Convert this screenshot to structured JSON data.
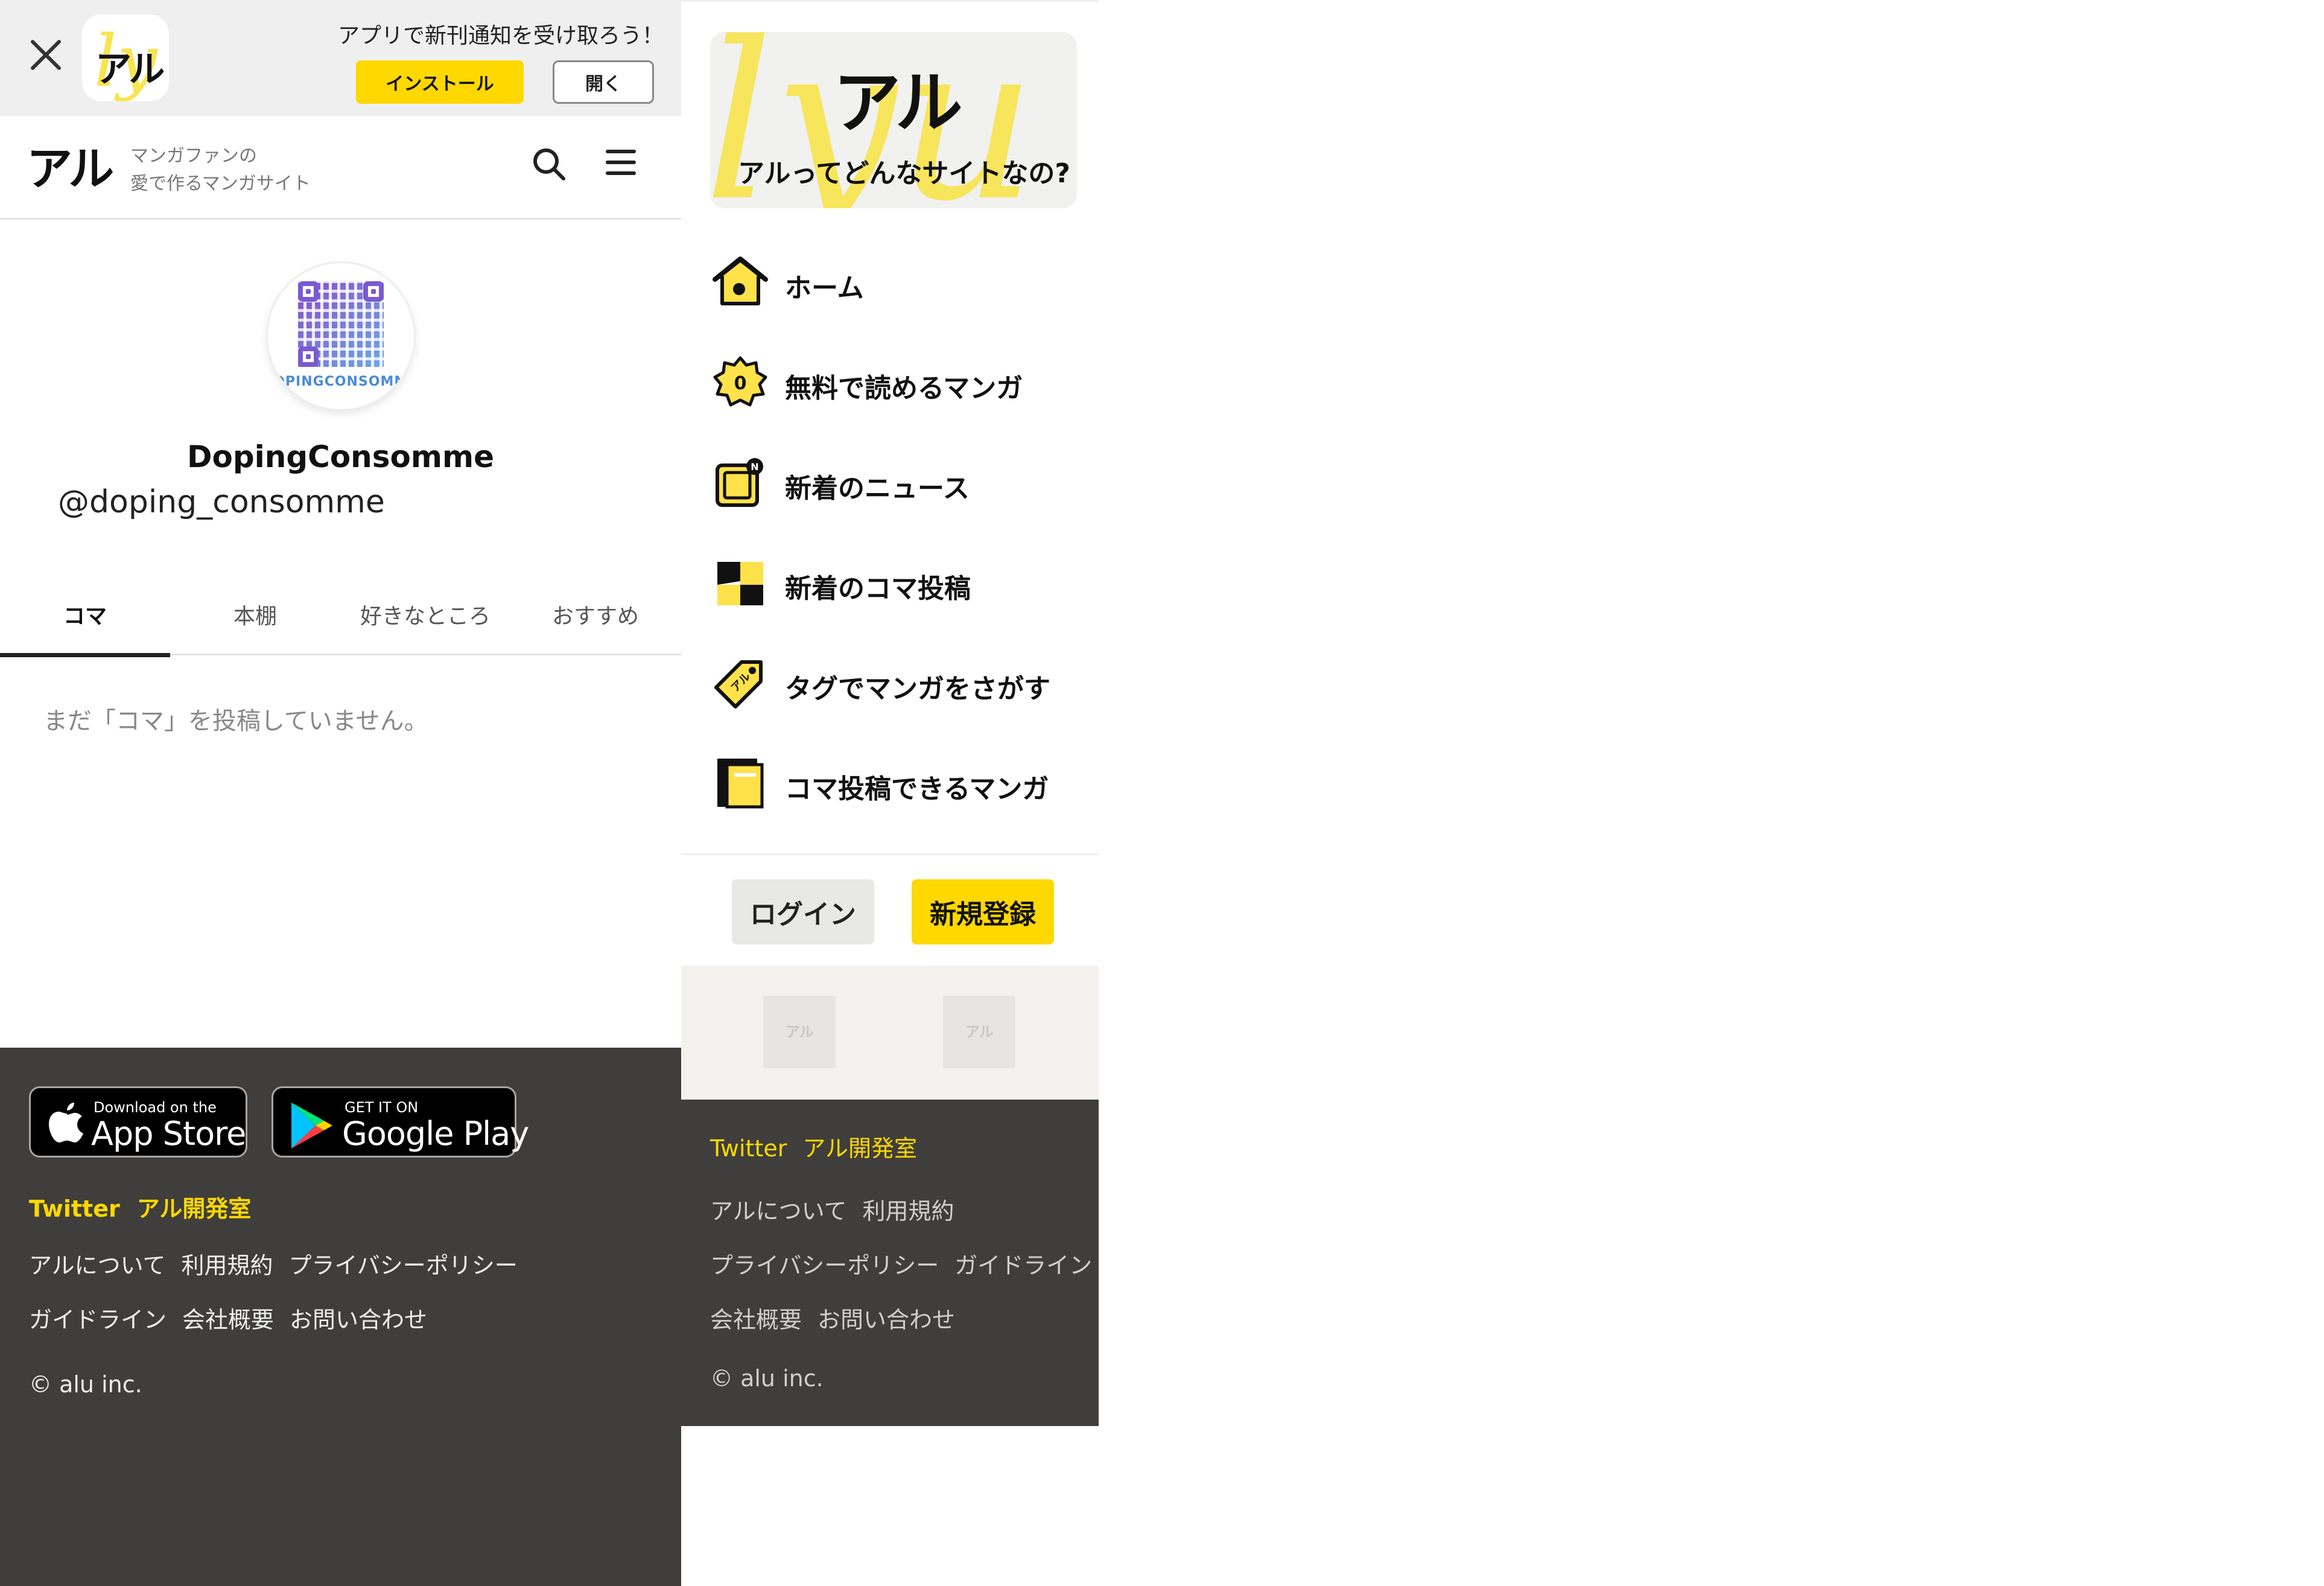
{
  "banner": {
    "message": "アプリで新刊通知を受け取ろう！",
    "install_label": "インストール",
    "open_label": "開く",
    "app_mark": "アル"
  },
  "header": {
    "logo": "アル",
    "tagline_line1": "マンガファンの",
    "tagline_line2": "愛で作るマンガサイト"
  },
  "profile": {
    "avatar_caption": "DPINGCONSOMM",
    "display_name": "DopingConsomme",
    "handle": "@doping_consomme"
  },
  "tabs": [
    {
      "label": "コマ",
      "active": true
    },
    {
      "label": "本棚",
      "active": false
    },
    {
      "label": "好きなところ",
      "active": false
    },
    {
      "label": "おすすめ",
      "active": false
    }
  ],
  "empty_message": "まだ「コマ」を投稿していません。",
  "footer": {
    "appstore_small": "Download on the",
    "appstore_big": "App Store",
    "google_small": "GET IT ON",
    "google_big": "Google Play",
    "social_links": [
      "Twitter",
      "アル開発室"
    ],
    "links_row1": [
      "アルについて",
      "利用規約",
      "プライバシーポリシー"
    ],
    "links_row2": [
      "ガイドライン",
      "会社概要",
      "お問い合わせ"
    ],
    "copyright": "© alu inc."
  },
  "side_menu": {
    "about_logo": "アル",
    "about_text": "アルってどんなサイトなの?",
    "items": [
      {
        "label": "ホーム",
        "icon": "home-icon"
      },
      {
        "label": "無料で読めるマンガ",
        "icon": "free-badge-icon"
      },
      {
        "label": "新着のニュース",
        "icon": "news-icon"
      },
      {
        "label": "新着のコマ投稿",
        "icon": "koma-icon"
      },
      {
        "label": "タグでマンガをさがす",
        "icon": "tag-icon"
      },
      {
        "label": "コマ投稿できるマンガ",
        "icon": "book-icon"
      }
    ],
    "login_label": "ログイン",
    "signup_label": "新規登録",
    "thumb_mark": "アル",
    "footer": {
      "social_links": [
        "Twitter",
        "アル開発室"
      ],
      "links_row1": [
        "アルについて",
        "利用規約"
      ],
      "links_row2": [
        "プライバシーポリシー",
        "ガイドライン"
      ],
      "links_row3": [
        "会社概要",
        "お問い合わせ"
      ],
      "copyright": "© alu inc."
    }
  },
  "colors": {
    "brand_yellow": "#ffd800",
    "footer_bg": "#3f3e3c",
    "banner_bg": "#efefef"
  }
}
